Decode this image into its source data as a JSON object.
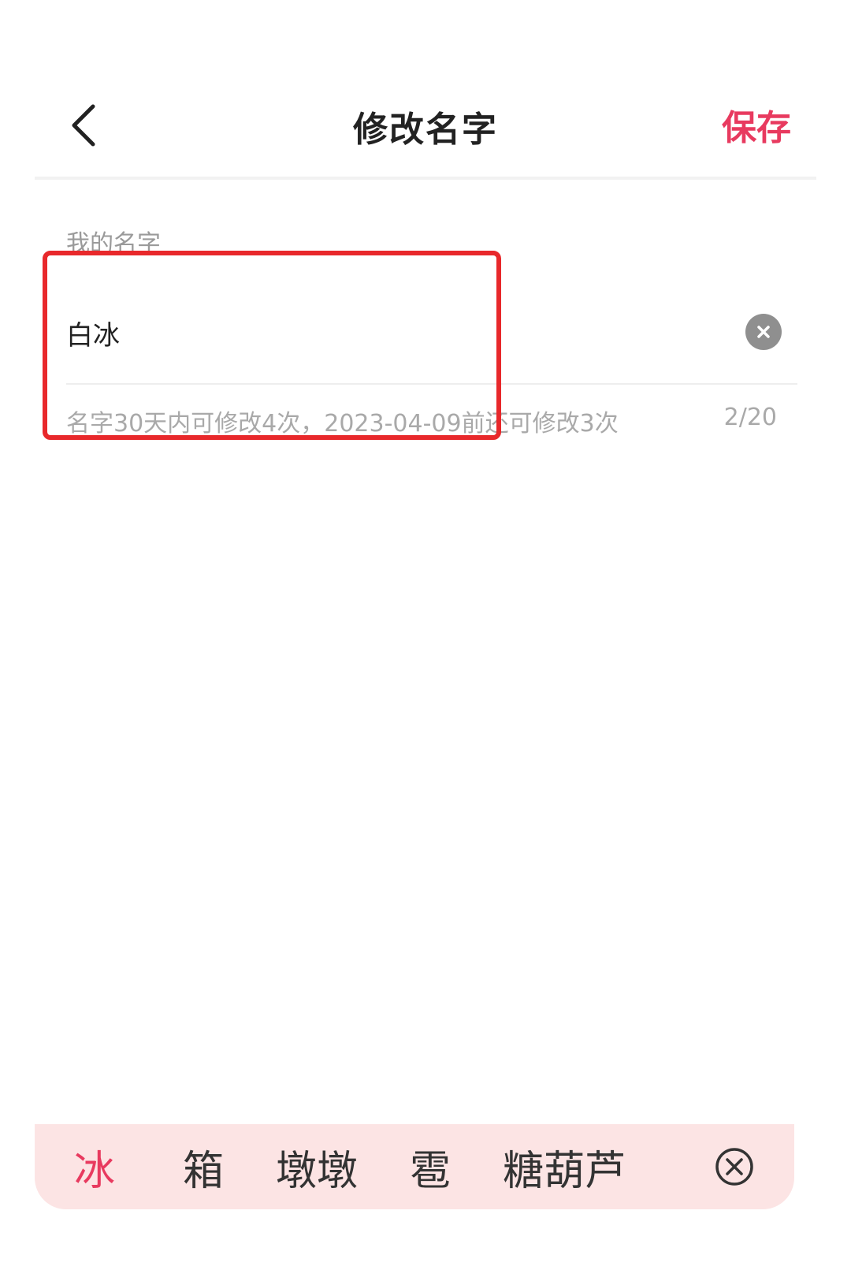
{
  "header": {
    "title": "修改名字",
    "save_label": "保存",
    "back_icon": "chevron-left-icon"
  },
  "form": {
    "label": "我的名字",
    "name_value": "白冰",
    "clear_icon": "clear-circle-icon",
    "hint": "名字30天内可修改4次，2023-04-09前还可修改3次",
    "char_count": "2/20"
  },
  "candidates": {
    "items": [
      "冰",
      "箱",
      "墩墩",
      "雹",
      "糖葫芦"
    ],
    "close_icon": "close-circle-icon"
  },
  "colors": {
    "accent": "#e83a5f",
    "highlight": "#e8282b",
    "candidate_bg": "#fce4e4"
  }
}
